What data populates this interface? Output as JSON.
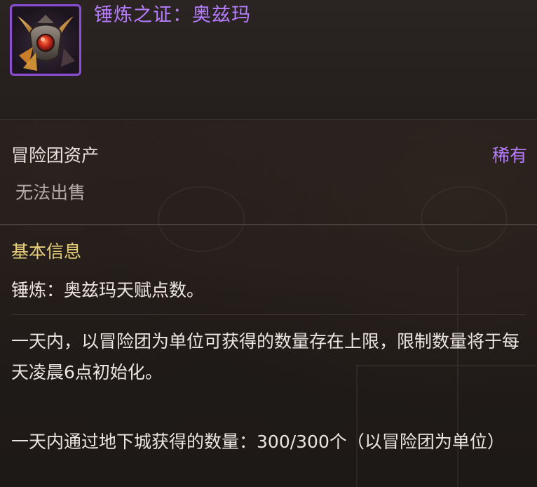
{
  "item": {
    "title": "锤炼之证：奥兹玛",
    "icon": "ozma-crest-icon",
    "rarity": "稀有",
    "category": "冒险团资产",
    "trade_status": "无法出售"
  },
  "basic_info": {
    "section_title": "基本信息",
    "description": "锤炼：奥兹玛天赋点数。",
    "daily_limit_note": "一天内，以冒险团为单位可获得的数量存在上限，限制数量将于每天凌晨6点初始化。",
    "dungeon_limit_note": "一天内通过地下城获得的数量：300/300个（以冒险团为单位）"
  },
  "colors": {
    "rarity_purple": "#b77cff",
    "section_gold": "#e8cf7a",
    "text_main": "#ebe6e0",
    "text_muted": "#b2aca6"
  }
}
